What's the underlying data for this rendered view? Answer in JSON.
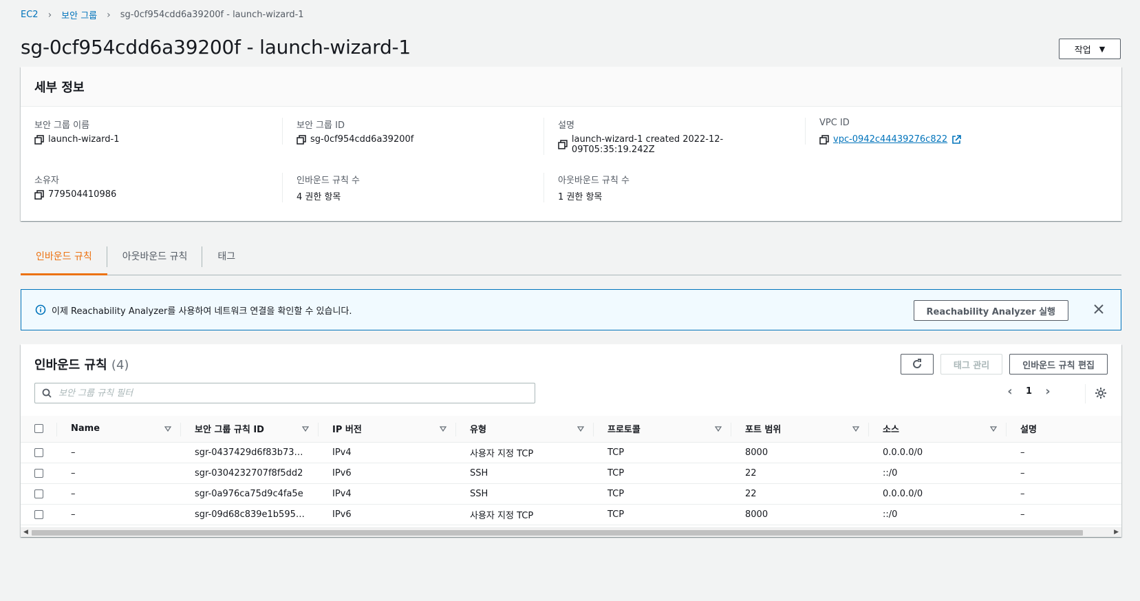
{
  "breadcrumb": {
    "root": "EC2",
    "parent": "보안 그룹",
    "current": "sg-0cf954cdd6a39200f - launch-wizard-1"
  },
  "page": {
    "title": "sg-0cf954cdd6a39200f - launch-wizard-1",
    "actions_label": "작업"
  },
  "details": {
    "title": "세부 정보",
    "fields": {
      "sg_name": {
        "label": "보안 그룹 이름",
        "value": "launch-wizard-1"
      },
      "sg_id": {
        "label": "보안 그룹 ID",
        "value": "sg-0cf954cdd6a39200f"
      },
      "description": {
        "label": "설명",
        "value": "launch-wizard-1 created 2022-12-09T05:35:19.242Z"
      },
      "vpc_id": {
        "label": "VPC ID",
        "value": "vpc-0942c44439276c822"
      },
      "owner": {
        "label": "소유자",
        "value": "779504410986"
      },
      "inbound_count": {
        "label": "인바운드 규칙 수",
        "value": "4 권한 항목"
      },
      "outbound_count": {
        "label": "아웃바운드 규칙 수",
        "value": "1 권한 항목"
      }
    }
  },
  "tabs": [
    {
      "label": "인바운드 규칙",
      "active": true
    },
    {
      "label": "아웃바운드 규칙",
      "active": false
    },
    {
      "label": "태그",
      "active": false
    }
  ],
  "banner": {
    "text": "이제 Reachability Analyzer를 사용하여 네트워크 연결을 확인할 수 있습니다.",
    "button": "Reachability Analyzer 실행"
  },
  "rules": {
    "title": "인바운드 규칙",
    "count": "(4)",
    "manage_tags": "태그 관리",
    "edit": "인바운드 규칙 편집",
    "search_placeholder": "보안 그룹 규칙 필터",
    "page": "1",
    "columns": [
      "Name",
      "보안 그룹 규칙 ID",
      "IP 버전",
      "유형",
      "프로토콜",
      "포트 범위",
      "소스",
      "설명"
    ],
    "rows": [
      {
        "name": "–",
        "id": "sgr-0437429d6f83b73…",
        "ip": "IPv4",
        "type": "사용자 지정 TCP",
        "protocol": "TCP",
        "port": "8000",
        "source": "0.0.0.0/0",
        "desc": "–"
      },
      {
        "name": "–",
        "id": "sgr-0304232707f8f5dd2",
        "ip": "IPv6",
        "type": "SSH",
        "protocol": "TCP",
        "port": "22",
        "source": "::/0",
        "desc": "–"
      },
      {
        "name": "–",
        "id": "sgr-0a976ca75d9c4fa5e",
        "ip": "IPv4",
        "type": "SSH",
        "protocol": "TCP",
        "port": "22",
        "source": "0.0.0.0/0",
        "desc": "–"
      },
      {
        "name": "–",
        "id": "sgr-09d68c839e1b595…",
        "ip": "IPv6",
        "type": "사용자 지정 TCP",
        "protocol": "TCP",
        "port": "8000",
        "source": "::/0",
        "desc": "–"
      }
    ]
  },
  "colors": {
    "link": "#0073bb",
    "active_tab": "#ec7211",
    "banner_bg": "#f1faff"
  }
}
